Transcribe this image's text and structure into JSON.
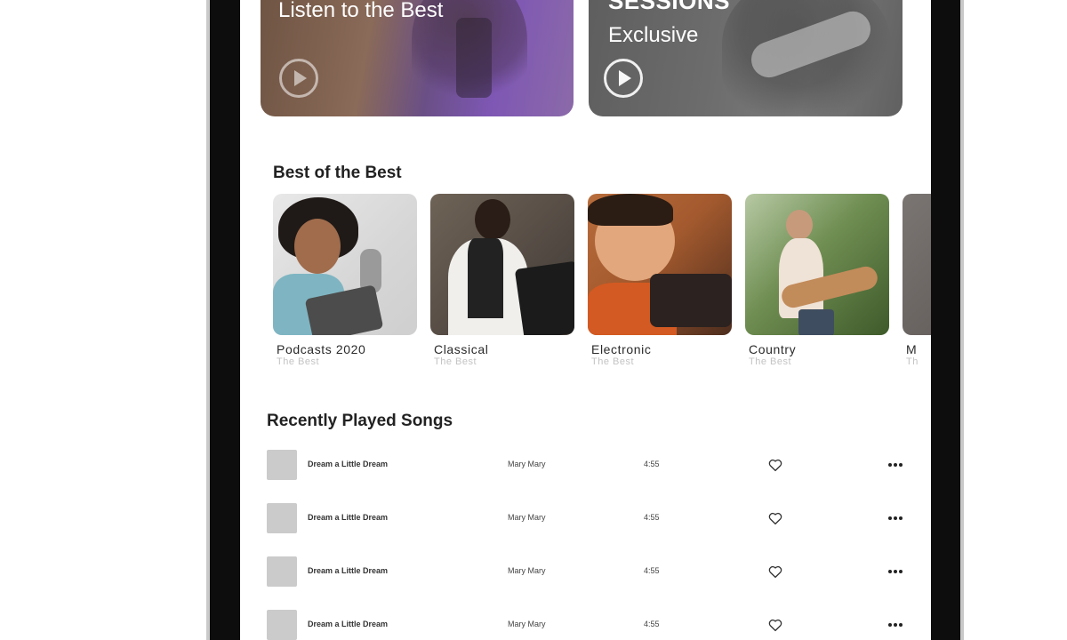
{
  "hero": [
    {
      "title": "Listen to the Best",
      "play_icon": "play-circle-icon"
    },
    {
      "title": "SESSIONS",
      "subtitle": "Exclusive",
      "play_icon": "play-circle-icon"
    }
  ],
  "best_of": {
    "title": "Best of the Best",
    "cards": [
      {
        "title": "Podcasts 2020",
        "subtitle": "The Best"
      },
      {
        "title": "Classical",
        "subtitle": "The Best"
      },
      {
        "title": "Electronic",
        "subtitle": "The Best"
      },
      {
        "title": "Country",
        "subtitle": "The Best"
      },
      {
        "title": "M",
        "subtitle": "Th"
      }
    ]
  },
  "recent": {
    "title": "Recently Played Songs",
    "songs": [
      {
        "title": "Dream a Little Dream",
        "artist": "Mary Mary",
        "duration": "4:55"
      },
      {
        "title": "Dream a Little Dream",
        "artist": "Mary Mary",
        "duration": "4:55"
      },
      {
        "title": "Dream a Little Dream",
        "artist": "Mary Mary",
        "duration": "4:55"
      },
      {
        "title": "Dream a Little Dream",
        "artist": "Mary Mary",
        "duration": "4:55"
      }
    ]
  },
  "colors": {
    "frame": "#0d0d0d",
    "thumb_placeholder": "#cbcbcb",
    "subtitle_gray": "#c3c3c3"
  }
}
